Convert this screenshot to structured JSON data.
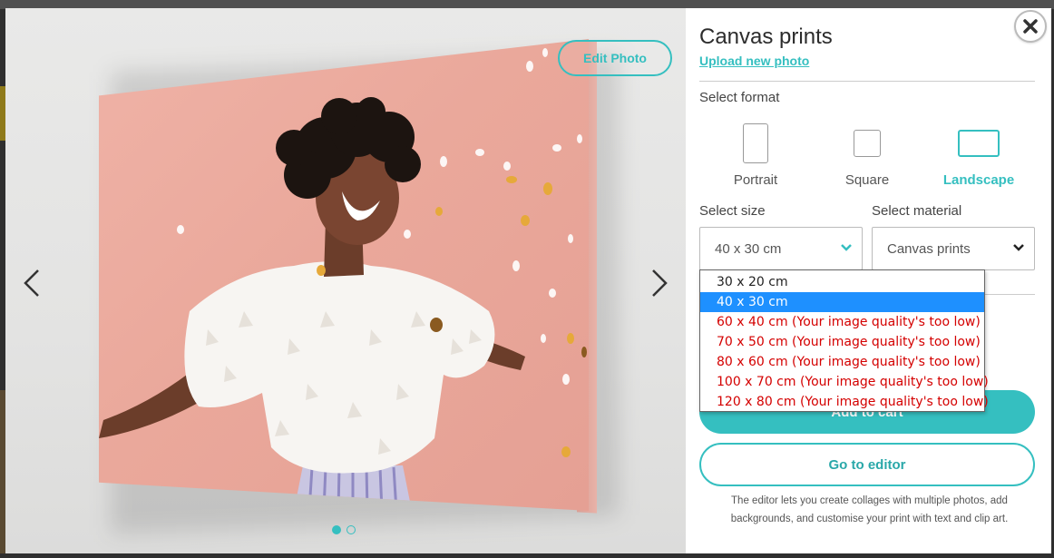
{
  "image_viewer": {
    "edit_photo_label": "Edit Photo",
    "prev_icon": "chevron-left-icon",
    "next_icon": "chevron-right-icon",
    "slide_count": 2,
    "active_slide": 1
  },
  "panel": {
    "title": "Canvas prints",
    "upload_link": "Upload new photo",
    "close_icon": "close-icon",
    "format_label": "Select format",
    "formats": [
      {
        "label": "Portrait",
        "selected": false
      },
      {
        "label": "Square",
        "selected": false
      },
      {
        "label": "Landscape",
        "selected": true
      }
    ],
    "size_label": "Select size",
    "size_value": "40 x 30 cm",
    "material_label": "Select material",
    "material_value": "Canvas prints",
    "add_to_cart_label": "Add to cart",
    "go_to_editor_label": "Go to editor",
    "editor_note": "The editor lets you create collages with multiple photos, add backgrounds, and customise your print with text and clip art."
  },
  "size_dropdown": {
    "options": [
      {
        "label": "30 x 20 cm",
        "state": "normal"
      },
      {
        "label": "40 x 30 cm",
        "state": "selected"
      },
      {
        "label": "60 x 40 cm (Your image quality's too low)",
        "state": "disabled"
      },
      {
        "label": "70 x 50 cm (Your image quality's too low)",
        "state": "disabled"
      },
      {
        "label": "80 x 60 cm (Your image quality's too low)",
        "state": "disabled"
      },
      {
        "label": "100 x 70 cm (Your image quality's too low)",
        "state": "disabled"
      },
      {
        "label": "120 x 80 cm (Your image quality's too low)",
        "state": "disabled"
      }
    ]
  },
  "colors": {
    "accent": "#35bfc0",
    "selected_option": "#1e90ff",
    "warning_text": "#d40000"
  }
}
